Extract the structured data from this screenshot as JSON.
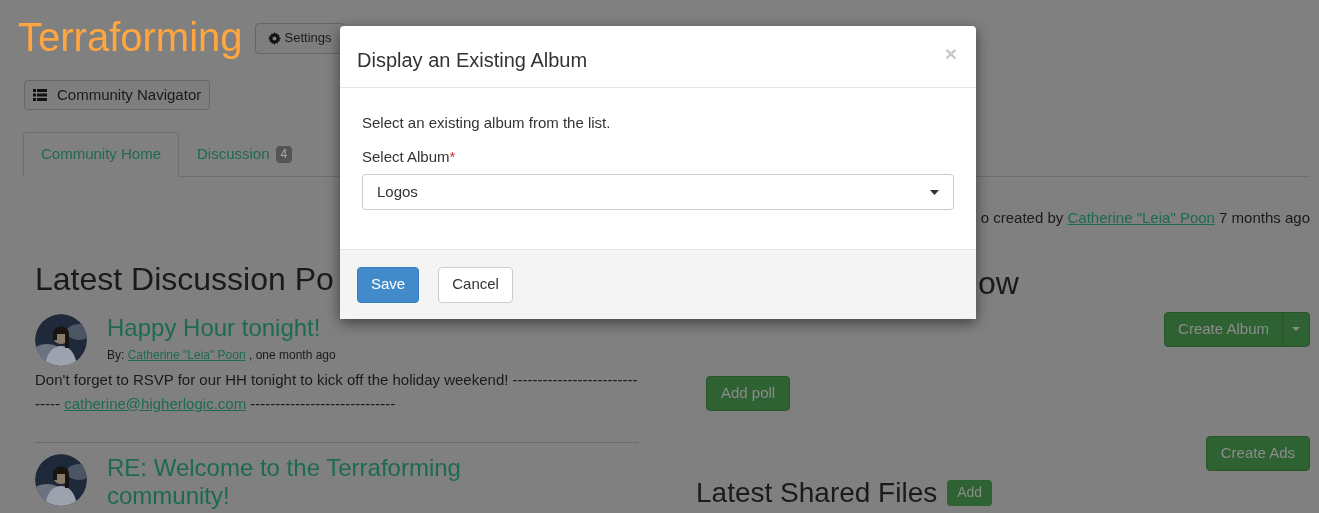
{
  "site_title": "Terraforming",
  "settings_button": {
    "label": "Settings"
  },
  "navigator_button": {
    "label": "Community Navigator"
  },
  "tabs": [
    {
      "label": "Community Home",
      "selected": true
    },
    {
      "label": "Discussion",
      "badge": "4",
      "selected": false
    }
  ],
  "activity_line": {
    "text_before": "o created by",
    "author": "Catherine \"Leia\" Poon",
    "time": "7 months ago"
  },
  "discussion": {
    "heading": "Latest Discussion Po",
    "posts": [
      {
        "title": "Happy Hour tonight!",
        "by_label": "By:",
        "author": "Catherine \"Leia\" Poon",
        "time": ", one month ago",
        "body_before": "Don't forget to RSVP for our HH tonight to kick off the holiday weekend! ------------------------------",
        "email": "catherine@higherlogic.com",
        "body_after": "-----------------------------"
      },
      {
        "title": "RE: Welcome to the Terraforming community!"
      }
    ]
  },
  "right_column": {
    "heading_fragment": "ow",
    "create_album": "Create Album",
    "add_poll": "Add poll",
    "create_ads": "Create Ads",
    "files_heading": "Latest Shared Files",
    "files_add": "Add"
  },
  "modal": {
    "title": "Display an Existing Album",
    "close": "×",
    "intro": "Select an existing album from the list.",
    "field_label": "Select Album",
    "required_mark": "*",
    "field_value": "Logos",
    "buttons": [
      {
        "label": "Save",
        "kind": "primary"
      },
      {
        "label": "Cancel",
        "kind": "default"
      }
    ]
  }
}
